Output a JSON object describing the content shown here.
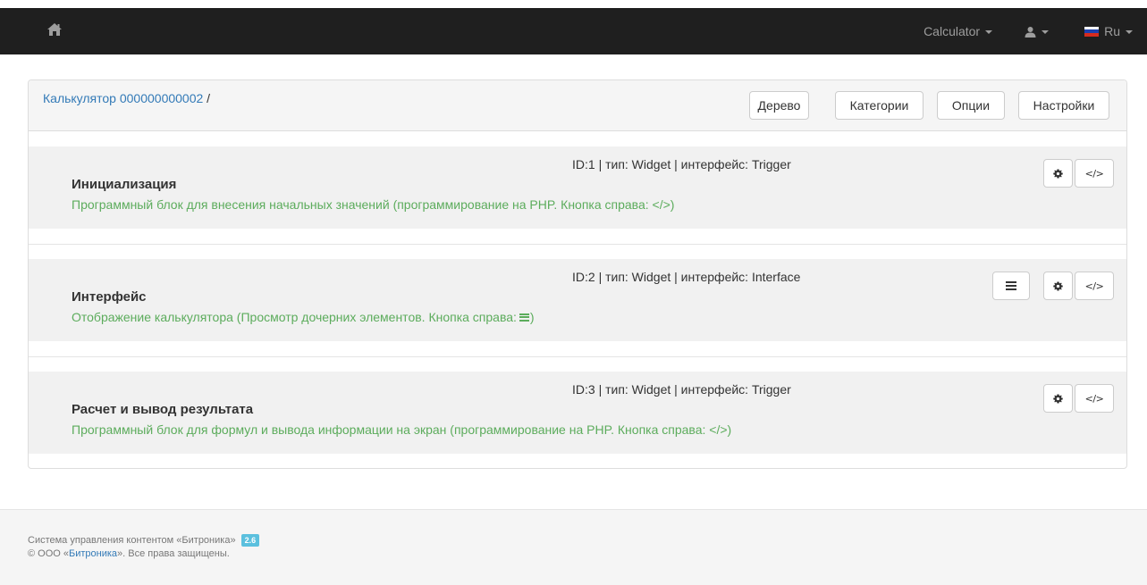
{
  "navbar": {
    "home_icon": "home-icon",
    "calculator_label": "Calculator",
    "user_icon": "user-icon",
    "language_label": "Ru",
    "flag_colors": [
      "#ffffff",
      "#1c3fae",
      "#d52b1e"
    ]
  },
  "header": {
    "breadcrumb_link": "Калькулятор 000000000002",
    "breadcrumb_sep": "/",
    "buttons": {
      "tree": "Дерево",
      "categories": "Категории",
      "options": "Опции",
      "settings": "Настройки"
    }
  },
  "blocks": [
    {
      "meta": "ID:1 | тип: Widget | интерфейс: Trigger",
      "title": "Инициализация",
      "desc_before": "Программный блок для внесения начальных значений (программирование на PHP. Кнопка справа: </>)",
      "desc_after": ""
    },
    {
      "meta": "ID:2 | тип: Widget | интерфейс: Interface",
      "title": "Интерфейс",
      "desc_before": "Отображение калькулятора (Просмотр дочерних элементов. Кнопка справа:",
      "desc_after": ")"
    },
    {
      "meta": "ID:3 | тип: Widget | интерфейс: Trigger",
      "title": "Расчет и вывод результата",
      "desc_before": "Программный блок для формул и вывода информации на экран (программирование на PHP. Кнопка справа: </>)",
      "desc_after": ""
    }
  ],
  "block_buttons": {
    "code_label": "</>",
    "settings_icon": "gear-icon",
    "list_icon": "list-icon"
  },
  "footer": {
    "line1": "Система управления контентом «Битроника»",
    "version": "2.6",
    "copyright_prefix": "© ООО «",
    "company_link": "Битроника",
    "copyright_suffix": "». Все права защищены."
  },
  "colors": {
    "navbar_bg": "#1f1f1f",
    "link": "#337ab7",
    "description_green": "#5cac5c",
    "badge": "#5bc0de"
  }
}
